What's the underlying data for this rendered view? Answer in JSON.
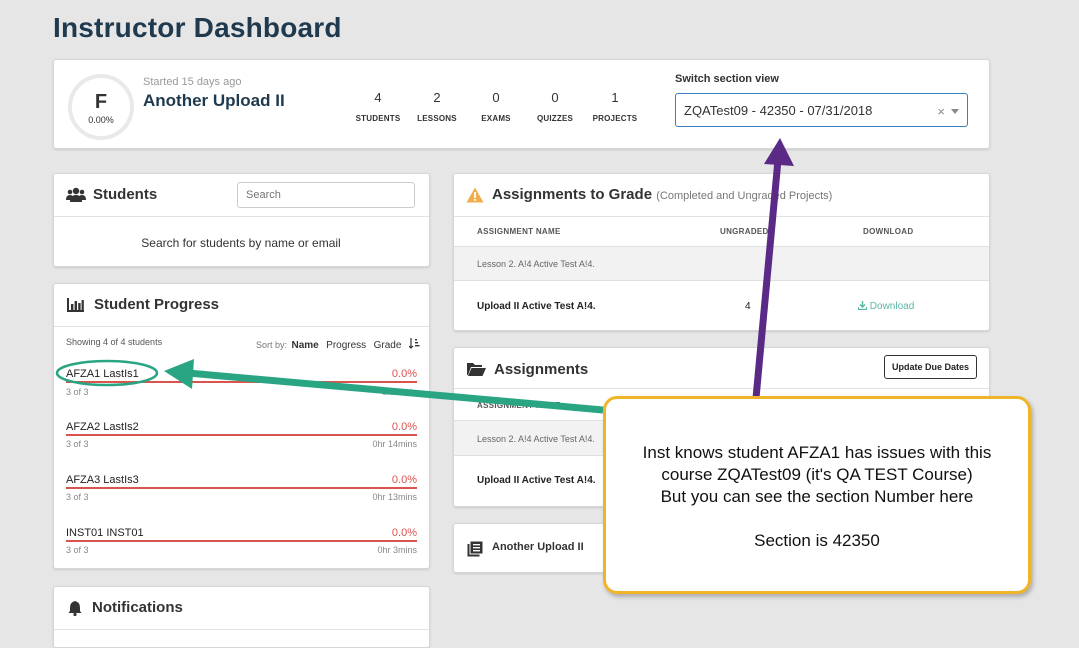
{
  "page": {
    "title": "Instructor Dashboard"
  },
  "course": {
    "grade_letter": "F",
    "grade_percent": "0.00%",
    "started": "Started 15 days ago",
    "name": "Another Upload II",
    "stats": [
      {
        "value": "4",
        "label": "STUDENTS"
      },
      {
        "value": "2",
        "label": "LESSONS"
      },
      {
        "value": "0",
        "label": "EXAMS"
      },
      {
        "value": "0",
        "label": "QUIZZES"
      },
      {
        "value": "1",
        "label": "PROJECTS"
      }
    ],
    "switch_label": "Switch section view",
    "section_value": "ZQATest09 - 42350 - 07/31/2018",
    "clear_glyph": "×"
  },
  "students_panel": {
    "title": "Students",
    "icon": "users-icon",
    "search_placeholder": "Search",
    "hint": "Search for students by name or email"
  },
  "progress_panel": {
    "title": "Student Progress",
    "icon": "bar-chart-icon",
    "showing": "Showing 4 of 4 students",
    "sort_label": "Sort by:",
    "sort_options": [
      "Name",
      "Progress",
      "Grade"
    ],
    "students": [
      {
        "name": "AFZA1 LastIs1",
        "percent": "0.0%",
        "lessons": "3 of 3",
        "time": "0hr 1min",
        "progress": 0
      },
      {
        "name": "AFZA2 LastIs2",
        "percent": "0.0%",
        "lessons": "3 of 3",
        "time": "0hr 14mins",
        "progress": 0
      },
      {
        "name": "AFZA3 LastIs3",
        "percent": "0.0%",
        "lessons": "3 of 3",
        "time": "0hr 13mins",
        "progress": 0
      },
      {
        "name": "INST01 INST01",
        "percent": "0.0%",
        "lessons": "3 of 3",
        "time": "0hr 3mins",
        "progress": 0
      }
    ]
  },
  "notifications_panel": {
    "title": "Notifications",
    "icon": "bell-icon"
  },
  "grade_panel": {
    "title": "Assignments to Grade",
    "subtitle": "(Completed and Ungraded Projects)",
    "icon": "warning-icon",
    "columns": [
      "ASSIGNMENT NAME",
      "UNGRADED",
      "DOWNLOAD"
    ],
    "group": "Lesson 2. A!4 Active Test A!4.",
    "row": {
      "name": "Upload II Active Test A!4.",
      "ungraded": "4",
      "download": "Download"
    }
  },
  "assignments_panel": {
    "title": "Assignments",
    "icon": "folder-open-icon",
    "button": "Update Due Dates",
    "column": "ASSIGNMENT NAME",
    "group": "Lesson 2. A!4 Active Test A!4.",
    "row": "Upload II Active Test A!4."
  },
  "course_panel": {
    "title": "Another Upload II",
    "icon": "book-icon"
  },
  "callout": {
    "lines": [
      "Inst knows student AFZA1 has issues with this",
      "course ZQATest09 (it's QA TEST Course)",
      "But you can see the section Number here",
      "",
      "Section is 42350"
    ]
  },
  "annotation_colors": {
    "arrow_purple": "#5b2a86",
    "arrow_teal": "#2aa583",
    "callout_border": "#f0b429",
    "progress_red": "#d9534f"
  }
}
